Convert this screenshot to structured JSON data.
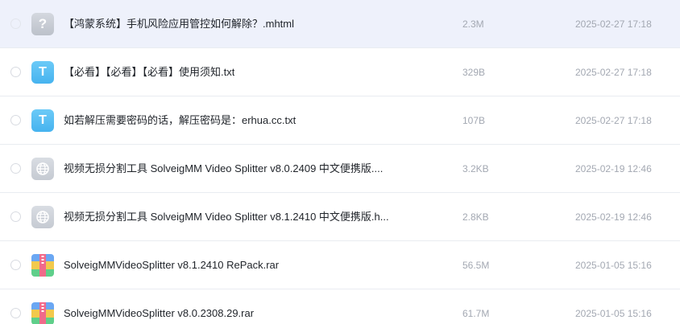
{
  "files": [
    {
      "icon": "unknown-file-icon",
      "icon_glyph": "?",
      "name": "【鸿蒙系统】手机风险应用管控如何解除？.mhtml",
      "size": "2.3M",
      "date": "2025-02-27 17:18"
    },
    {
      "icon": "txt-file-icon",
      "icon_glyph": "T",
      "name": "【必看】【必看】【必看】使用须知.txt",
      "size": "329B",
      "date": "2025-02-27 17:18"
    },
    {
      "icon": "txt-file-icon",
      "icon_glyph": "T",
      "name": "如若解压需要密码的话，解压密码是：erhua.cc.txt",
      "size": "107B",
      "date": "2025-02-27 17:18"
    },
    {
      "icon": "web-file-icon",
      "icon_glyph": "",
      "name": "视频无损分割工具 SolveigMM Video Splitter v8.0.2409 中文便携版....",
      "size": "3.2KB",
      "date": "2025-02-19 12:46"
    },
    {
      "icon": "web-file-icon",
      "icon_glyph": "",
      "name": "视频无损分割工具 SolveigMM Video Splitter v8.1.2410 中文便携版.h...",
      "size": "2.8KB",
      "date": "2025-02-19 12:46"
    },
    {
      "icon": "rar-file-icon",
      "icon_glyph": "",
      "name": "SolveigMMVideoSplitter v8.1.2410 RePack.rar",
      "size": "56.5M",
      "date": "2025-01-05 15:16"
    },
    {
      "icon": "rar-file-icon",
      "icon_glyph": "",
      "name": "SolveigMMVideoSplitter v8.0.2308.29.rar",
      "size": "61.7M",
      "date": "2025-01-05 15:16"
    }
  ],
  "colors": {
    "hover_row_bg": "#eef1fb",
    "txt_icon": "#46b3ef",
    "muted_text": "#a3a8b2",
    "primary_text": "#1f2329"
  }
}
